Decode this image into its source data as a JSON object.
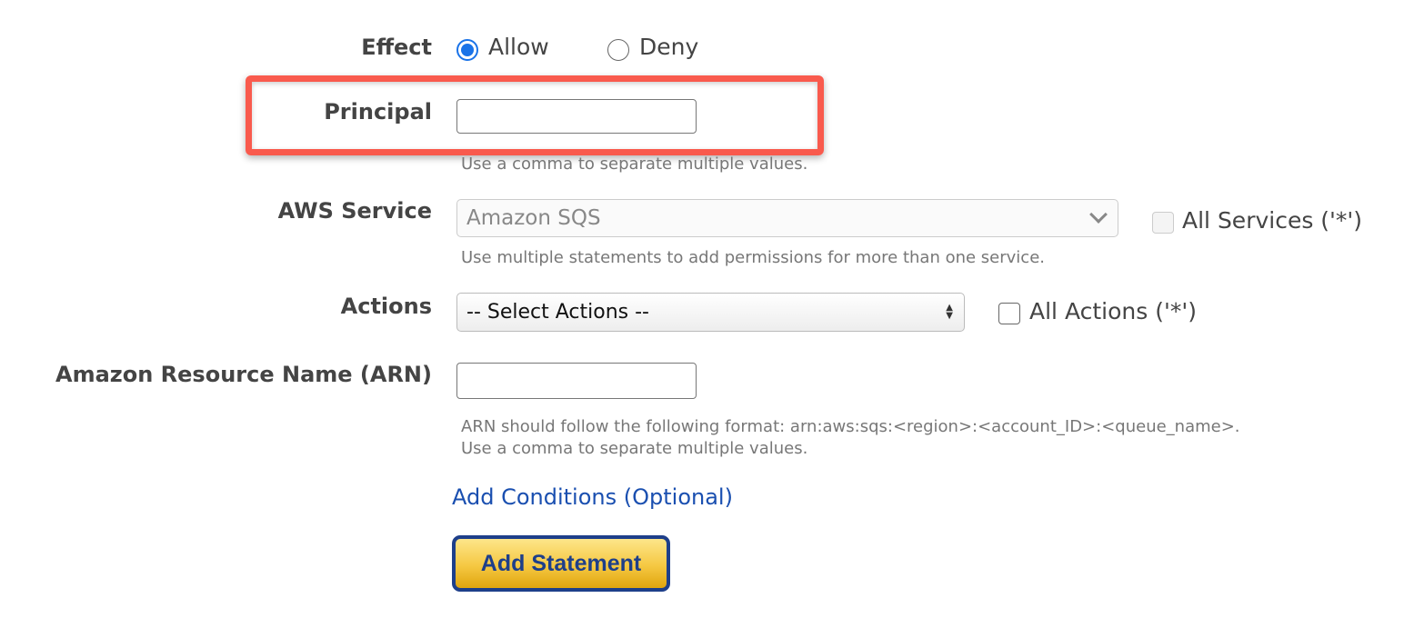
{
  "effect": {
    "label": "Effect",
    "options": [
      {
        "label": "Allow",
        "selected": true
      },
      {
        "label": "Deny",
        "selected": false
      }
    ]
  },
  "principal": {
    "label": "Principal",
    "value": "",
    "help": "Use a comma to separate multiple values.",
    "highlight_color": "#f95a4d"
  },
  "aws_service": {
    "label": "AWS Service",
    "selected": "Amazon SQS",
    "help": "Use multiple statements to add permissions for more than one service.",
    "all_label": "All Services ('*')",
    "all_checked": false
  },
  "actions": {
    "label": "Actions",
    "selected": "-- Select Actions --",
    "all_label": "All Actions ('*')",
    "all_checked": false
  },
  "arn": {
    "label": "Amazon Resource Name (ARN)",
    "value": "",
    "help_line1": "ARN should follow the following format: arn:aws:sqs:<region>:<account_ID>:<queue_name>.",
    "help_line2": "Use a comma to separate multiple values."
  },
  "add_conditions": "Add Conditions (Optional)",
  "add_statement": "Add Statement"
}
